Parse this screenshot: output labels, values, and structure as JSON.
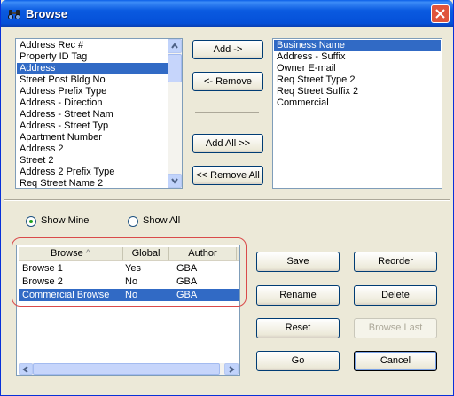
{
  "window": {
    "title": "Browse"
  },
  "available_fields": {
    "items": [
      "Address Rec #",
      "Property ID Tag",
      "Address",
      "Street Post Bldg No",
      "Address Prefix Type",
      "Address - Direction",
      "Address - Street Nam",
      "Address - Street Typ",
      "Apartment Number",
      "Address 2",
      "Street 2",
      "Address 2 Prefix Type",
      "Req Street Name 2"
    ],
    "selected": "Address"
  },
  "buttons_mid": {
    "add": "Add ->",
    "remove": "<- Remove",
    "add_all": "Add All >>",
    "remove_all": "<< Remove All"
  },
  "selected_fields": {
    "items": [
      "Business Name",
      "Address - Suffix",
      "Owner E-mail",
      "Req Street Type 2",
      "Req Street Suffix 2",
      "Commercial"
    ],
    "selected": "Business Name"
  },
  "filter": {
    "show_mine": "Show Mine",
    "show_all": "Show All",
    "selected": "show_mine"
  },
  "browse_grid": {
    "columns": [
      "Browse",
      "Global",
      "Author"
    ],
    "sort_indicator": "^",
    "rows": [
      {
        "browse": "Browse 1",
        "global": "Yes",
        "author": "GBA"
      },
      {
        "browse": "Browse 2",
        "global": "No",
        "author": "GBA"
      },
      {
        "browse": "Commercial Browse",
        "global": "No",
        "author": "GBA"
      }
    ],
    "selected_row": "Commercial Browse"
  },
  "actions": {
    "save": "Save",
    "reorder": "Reorder",
    "rename": "Rename",
    "delete": "Delete",
    "reset": "Reset",
    "browse_last": "Browse Last",
    "go": "Go",
    "cancel": "Cancel"
  },
  "colors": {
    "selection": "#316ac5",
    "title_bar": "#0a5ae0",
    "highlight_outline": "#d94a4a"
  }
}
